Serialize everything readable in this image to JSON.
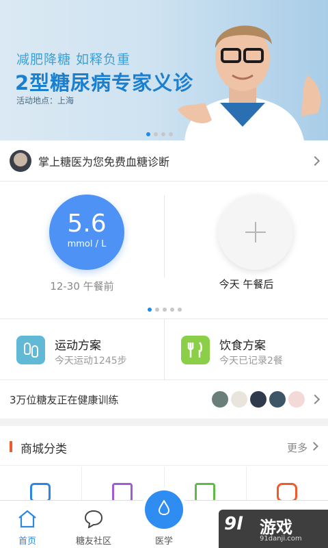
{
  "banner": {
    "subtitle": "减肥降糖 如释负重",
    "title": "2型糖尿病专家义诊",
    "place": "活动地点：上海",
    "page_dots": 4,
    "active_dot": 0
  },
  "notice": {
    "text": "掌上糖医为您免费血糖诊断"
  },
  "glucose": {
    "value": "5.6",
    "unit": "mmol / L",
    "measured_at": "12-30 午餐前",
    "next_label": "今天 午餐后",
    "page_dots": 5,
    "active_dot": 0
  },
  "plans": {
    "sport": {
      "name": "运动方案",
      "desc": "今天运动1245步"
    },
    "diet": {
      "name": "饮食方案",
      "desc": "今天已记录2餐"
    }
  },
  "training": {
    "text": "3万位糖友正在健康训练",
    "avatars": [
      "#6b7f7a",
      "#e9e4dc",
      "#2f3a4d",
      "#3d5566",
      "#f3d9d8"
    ]
  },
  "mall": {
    "title": "商城分类",
    "more": "更多",
    "accent": "#f05a28",
    "categories": [
      {
        "icon": "glucometer-icon",
        "color": "#2a87e6"
      },
      {
        "icon": "medicine-jar-icon",
        "color": "#a15bd4"
      },
      {
        "icon": "heart-jar-icon",
        "color": "#5fbb46"
      },
      {
        "icon": "shopping-bag-icon",
        "color": "#f05a28"
      }
    ]
  },
  "tabbar": {
    "home": "首页",
    "community": "糖友社区",
    "medicine": "医学"
  },
  "watermark": {
    "logo": "9l",
    "name": "游戏",
    "url": "91danji.com"
  }
}
